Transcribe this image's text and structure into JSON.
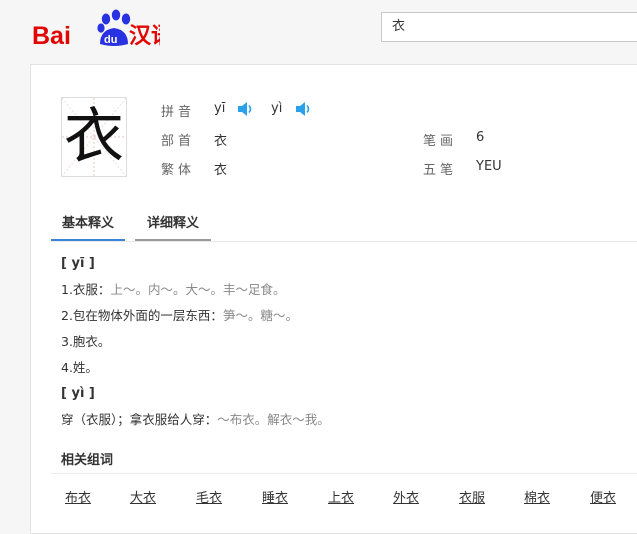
{
  "header": {
    "logo": {
      "bai": "Bai",
      "du": "du",
      "hanyu": "汉语"
    },
    "search_value": "衣",
    "colors": {
      "red": "#e10602",
      "blue": "#2932e1"
    }
  },
  "character": "衣",
  "info": {
    "pinyin_label": "拼音",
    "pinyin": [
      "yī",
      "yì"
    ],
    "bushou_label": "部首",
    "bushou": "衣",
    "bihua_label": "笔画",
    "bihua": "6",
    "fanti_label": "繁体",
    "fanti": "衣",
    "wubi_label": "五笔",
    "wubi": "YEU"
  },
  "tabs": {
    "basic": "基本释义",
    "detail": "详细释义"
  },
  "definitions": {
    "head1": "[ yī ]",
    "d1": {
      "text": "1.衣服：",
      "ex": "上～。内～。大～。丰～足食。"
    },
    "d2": {
      "text": "2.包在物体外面的一层东西：",
      "ex": "笋～。糖～。"
    },
    "d3": "3.胞衣。",
    "d4": "4.姓。",
    "head2": "[ yì ]",
    "d5": {
      "text": "穿（衣服）；拿衣服给人穿：",
      "ex": "～布衣。解衣～我。"
    }
  },
  "related": {
    "title": "相关组词",
    "words": [
      "布衣",
      "大衣",
      "毛衣",
      "睡衣",
      "上衣",
      "外衣",
      "衣服",
      "棉衣",
      "便衣"
    ]
  }
}
